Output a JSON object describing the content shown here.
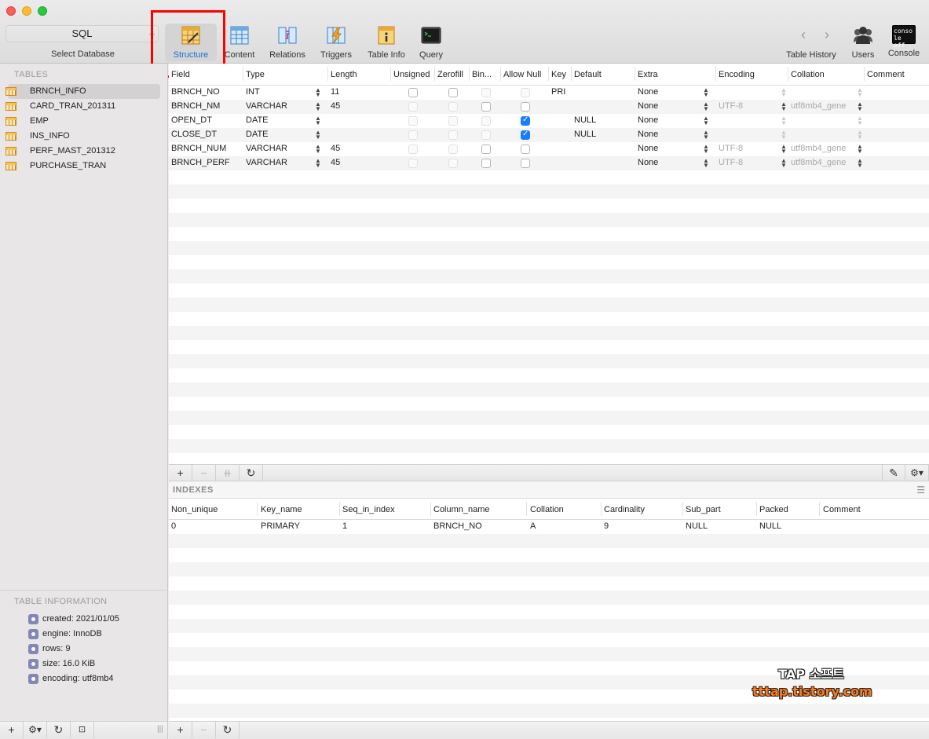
{
  "toolbar": {
    "database": "SQL",
    "select_database_label": "Select Database",
    "buttons": [
      {
        "label": "Structure",
        "icon": "structure-icon"
      },
      {
        "label": "Content",
        "icon": "content-icon"
      },
      {
        "label": "Relations",
        "icon": "relations-icon"
      },
      {
        "label": "Triggers",
        "icon": "triggers-icon"
      },
      {
        "label": "Table Info",
        "icon": "table-info-icon"
      },
      {
        "label": "Query",
        "icon": "query-icon"
      }
    ],
    "right_buttons": [
      {
        "label": "Table History"
      },
      {
        "label": "Users"
      },
      {
        "label": "Console"
      }
    ],
    "console_icon_text": "conso le off"
  },
  "sidebar": {
    "tables_header": "TABLES",
    "tables": [
      "BRNCH_INFO",
      "CARD_TRAN_201311",
      "EMP",
      "INS_INFO",
      "PERF_MAST_201312",
      "PURCHASE_TRAN"
    ],
    "selected_table": "BRNCH_INFO",
    "info_header": "TABLE INFORMATION",
    "info": [
      "created: 2021/01/05",
      "engine: InnoDB",
      "rows: 9",
      "size: 16.0 KiB",
      "encoding: utf8mb4"
    ]
  },
  "structure": {
    "columns": [
      "Field",
      "Type",
      "Length",
      "Unsigned",
      "Zerofill",
      "Bin...",
      "Allow Null",
      "Key",
      "Default",
      "Extra",
      "Encoding",
      "Collation",
      "Comment"
    ],
    "rows": [
      {
        "field": "BRNCH_NO",
        "type": "INT",
        "length": "11",
        "allow_null": false,
        "key": "PRI",
        "default": "",
        "extra": "None",
        "encoding": "",
        "collation": ""
      },
      {
        "field": "BRNCH_NM",
        "type": "VARCHAR",
        "length": "45",
        "allow_null": false,
        "key": "",
        "default": "",
        "extra": "None",
        "encoding": "UTF-8",
        "collation": "utf8mb4_gene"
      },
      {
        "field": "OPEN_DT",
        "type": "DATE",
        "length": "",
        "allow_null": true,
        "key": "",
        "default": "NULL",
        "extra": "None",
        "encoding": "",
        "collation": ""
      },
      {
        "field": "CLOSE_DT",
        "type": "DATE",
        "length": "",
        "allow_null": true,
        "key": "",
        "default": "NULL",
        "extra": "None",
        "encoding": "",
        "collation": ""
      },
      {
        "field": "BRNCH_NUM",
        "type": "VARCHAR",
        "length": "45",
        "allow_null": false,
        "key": "",
        "default": "",
        "extra": "None",
        "encoding": "UTF-8",
        "collation": "utf8mb4_gene"
      },
      {
        "field": "BRNCH_PERF",
        "type": "VARCHAR",
        "length": "45",
        "allow_null": false,
        "key": "",
        "default": "",
        "extra": "None",
        "encoding": "UTF-8",
        "collation": "utf8mb4_gene"
      }
    ]
  },
  "indexes": {
    "title": "INDEXES",
    "columns": [
      "Non_unique",
      "Key_name",
      "Seq_in_index",
      "Column_name",
      "Collation",
      "Cardinality",
      "Sub_part",
      "Packed",
      "Comment"
    ],
    "rows": [
      [
        "0",
        "PRIMARY",
        "1",
        "BRNCH_NO",
        "A",
        "9",
        "NULL",
        "NULL",
        ""
      ]
    ]
  },
  "watermark": {
    "line1": "TAP 소프트",
    "line2": "tttap.tistory.com"
  },
  "colors": {
    "accent": "#1a6ed8",
    "highlight": "#ff0000",
    "checkbox_on": "#1a7ff5"
  }
}
